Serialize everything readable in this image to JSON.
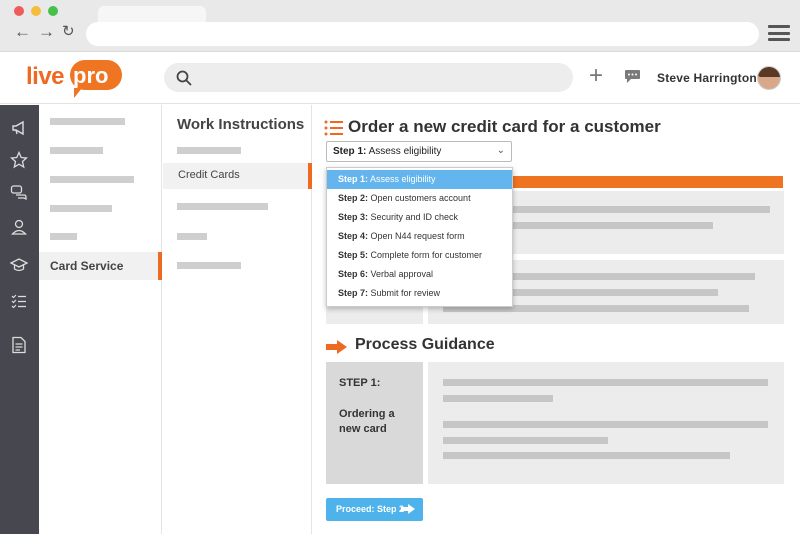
{
  "header": {
    "user_name": "Steve  Harrington",
    "logo_live": "live",
    "logo_pro": "pro"
  },
  "sidebar": {
    "active_item": "Card Service"
  },
  "work_instructions": {
    "title": "Work Instructions",
    "active_item": "Credit Cards"
  },
  "main": {
    "title": "Order a new credit card for a customer",
    "select": {
      "prefix": "Step 1:",
      "text": " Assess eligibility"
    },
    "dropdown": [
      {
        "prefix": "Step 1:",
        "text": " Assess eligibility",
        "selected": true
      },
      {
        "prefix": "Step 2:",
        "text": " Open customers account",
        "selected": false
      },
      {
        "prefix": "Step 3:",
        "text": " Security and ID check",
        "selected": false
      },
      {
        "prefix": "Step 4:",
        "text": " Open N44 request form",
        "selected": false
      },
      {
        "prefix": "Step 5:",
        "text": " Complete form for customer",
        "selected": false
      },
      {
        "prefix": "Step 6:",
        "text": " Verbal approval",
        "selected": false
      },
      {
        "prefix": "Step 7:",
        "text": " Submit for review",
        "selected": false
      }
    ],
    "guidance_title": "Process Guidance",
    "step_label": "STEP 1:",
    "step_name": "Ordering a new card",
    "proceed_label": "Proceed: Step 2"
  },
  "colors": {
    "accent": "#ee6a23",
    "sidebar_bg": "#47474f",
    "highlight": "#64b4ee",
    "button": "#4db3ea"
  }
}
